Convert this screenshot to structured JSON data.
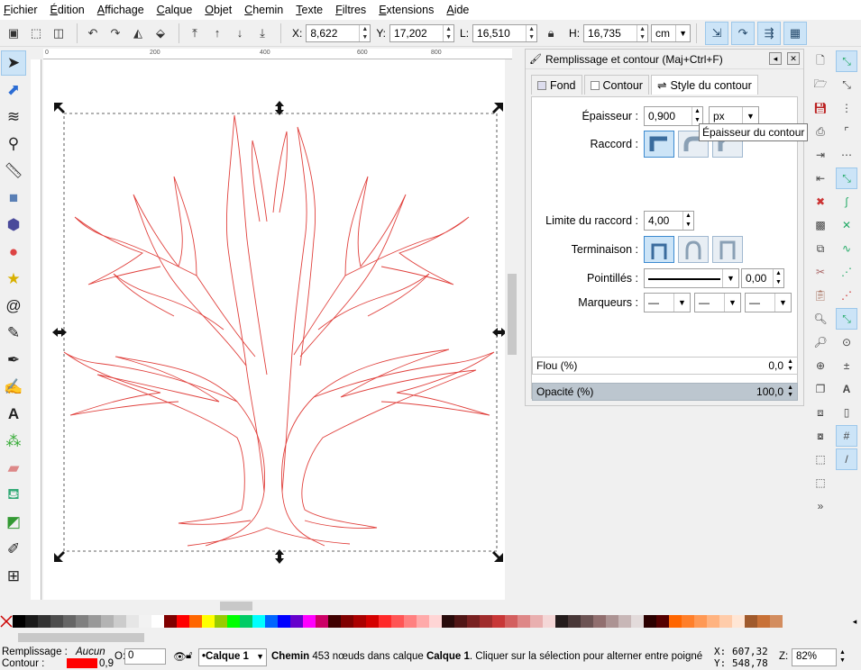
{
  "menu": [
    "Fichier",
    "Édition",
    "Affichage",
    "Calque",
    "Objet",
    "Chemin",
    "Texte",
    "Filtres",
    "Extensions",
    "Aide"
  ],
  "toolbar": {
    "x_label": "X:",
    "x_value": "8,622",
    "y_label": "Y:",
    "y_value": "17,202",
    "w_label": "L:",
    "w_value": "16,510",
    "h_label": "H:",
    "h_value": "16,735",
    "unit": "cm"
  },
  "ruler": {
    "ticks": [
      "0",
      "200",
      "400",
      "600",
      "800"
    ]
  },
  "dialog": {
    "title": "Remplissage et contour (Maj+Ctrl+F)",
    "tabs": [
      "Fond",
      "Contour",
      "Style du contour"
    ],
    "width_label": "Épaisseur :",
    "width_value": "0,900",
    "width_unit": "px",
    "tooltip": "Épaisseur du contour",
    "join_label": "Raccord :",
    "miter_label": "Limite du raccord :",
    "miter_value": "4,00",
    "cap_label": "Terminaison :",
    "dash_label": "Pointillés :",
    "dash_offset": "0,00",
    "markers_label": "Marqueurs :",
    "marker_placeholder": "—"
  },
  "blur": {
    "label": "Flou (%)",
    "value": "0,0"
  },
  "opacity": {
    "label": "Opacité (%)",
    "value": "100,0"
  },
  "palette": {
    "colors": [
      "#000000",
      "#1a1a1a",
      "#333333",
      "#4d4d4d",
      "#666666",
      "#808080",
      "#999999",
      "#b3b3b3",
      "#cccccc",
      "#e6e6e6",
      "#f2f2f2",
      "#ffffff",
      "#800000",
      "#ff0000",
      "#ff6600",
      "#ffff00",
      "#99cc00",
      "#00ff00",
      "#00cc66",
      "#00ffff",
      "#0066ff",
      "#0000ff",
      "#6600cc",
      "#ff00ff",
      "#cc0066",
      "#400000",
      "#800000",
      "#aa0000",
      "#d40000",
      "#ff2a2a",
      "#ff5555",
      "#ff8080",
      "#ffaaaa",
      "#ffd5d5",
      "#280b0b",
      "#501616",
      "#782121",
      "#a02c2c",
      "#c83737",
      "#d35f5f",
      "#de8787",
      "#e9afaf",
      "#f4d7d7",
      "#241c1c",
      "#483737",
      "#6c5353",
      "#916f6f",
      "#ac9393",
      "#c8b7b7",
      "#e3dbdb",
      "#2b0000",
      "#550000",
      "#ff6600",
      "#ff7f2a",
      "#ff9955",
      "#ffb380",
      "#ffccaa",
      "#ffe6d5",
      "#a05a2c",
      "#c87137",
      "#d38d5f"
    ]
  },
  "status": {
    "fill_label": "Remplissage :",
    "fill_value": "Aucun",
    "stroke_label": "Contour :",
    "stroke_color": "#ff0000",
    "stroke_width": "0,9",
    "opacity_label": "O:",
    "opacity_value": "0",
    "layer": "•Calque 1",
    "message_bold1": "Chemin",
    "message_mid": " 453 nœuds dans calque ",
    "message_bold2": "Calque 1",
    "message_tail": ". Cliquer sur la sélection pour alterner entre poigné",
    "cursor_x_label": "X:",
    "cursor_x": "607,32",
    "cursor_y_label": "Y:",
    "cursor_y": "548,78",
    "zoom_label": "Z:",
    "zoom": "82%"
  },
  "colors": {
    "accent": "#cce4f7",
    "stroke": "#e0403c"
  }
}
